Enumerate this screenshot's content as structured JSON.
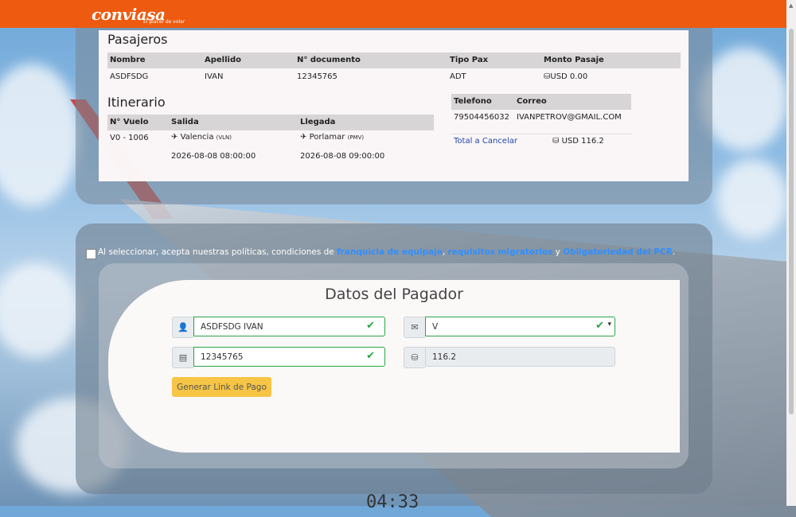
{
  "brand": {
    "logo": "conviasa",
    "tagline": "El placer de volar"
  },
  "passengers": {
    "title": "Pasajeros",
    "headers": [
      "Nombre",
      "Apellido",
      "N° documento",
      "Tipo Pax",
      "Monto Pasaje"
    ],
    "rows": [
      [
        "ASDFSDG",
        "IVAN",
        "12345765",
        "ADT",
        "USD 0.00"
      ]
    ]
  },
  "itinerary": {
    "title": "Itinerario",
    "headers": [
      "N° Vuelo",
      "Salida",
      "Llegada"
    ],
    "flight": "V0 - 1006",
    "depart_city": "Valencia",
    "depart_code": "(VLN)",
    "depart_time": "2026-08-08 08:00:00",
    "arrive_city": "Porlamar",
    "arrive_code": "(PMV)",
    "arrive_time": "2026-08-08 09:00:00"
  },
  "contact": {
    "headers": [
      "Telefono",
      "Correo"
    ],
    "phone": "79504456032",
    "email": "IVANPETROV@GMAIL.COM",
    "total_label": "Total a Cancelar",
    "total_value": "USD 116.2"
  },
  "policy": {
    "text1": "Al seleccionar, acepta nuestras políticas, condiciones de",
    "link1": "franquicia de equipaje",
    "sep1": ",",
    "link2": "requisitos migratorios",
    "sep2": "y",
    "link3": "Obligatoriedad del PCR",
    "end": "."
  },
  "payer": {
    "title": "Datos del Pagador",
    "name_value": "ASDFSDG IVAN",
    "email_value": "V",
    "doc_value": "12345765",
    "amount_value": "116.2",
    "button_label": "Generar Link de Pago"
  },
  "timer": "04:33",
  "colors": {
    "brand_orange": "#ee5a0f",
    "link_blue": "#2f8fff",
    "button_yellow": "#f6c545",
    "valid_green": "#28a745"
  }
}
